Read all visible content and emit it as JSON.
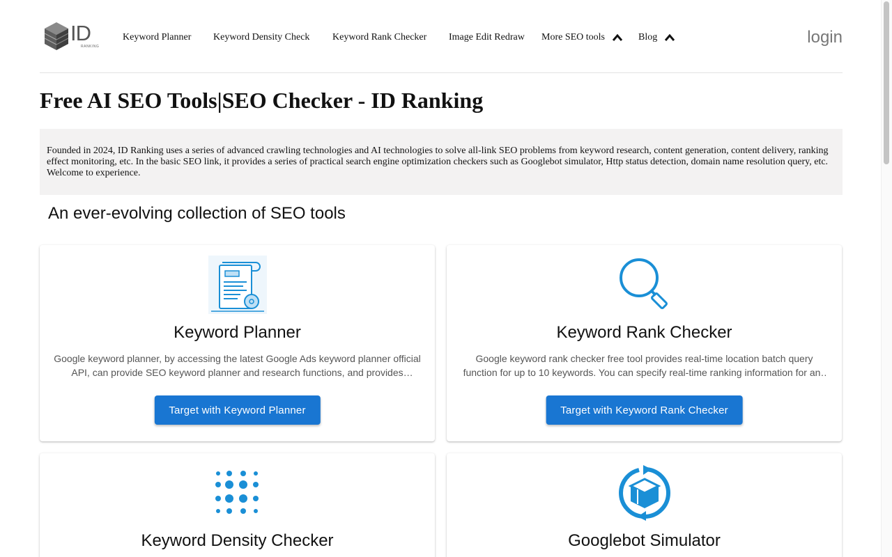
{
  "brand": {
    "logo_text": "ID",
    "logo_sub": "RANKING"
  },
  "nav": {
    "items": [
      {
        "label": "Keyword Planner"
      },
      {
        "label": "Keyword Density Check"
      },
      {
        "label": "Keyword Rank Checker"
      },
      {
        "label": "Image Edit Redraw"
      },
      {
        "label": "More SEO tools",
        "icon": "chevron-up-icon"
      },
      {
        "label": "Blog",
        "icon": "chevron-up-icon"
      }
    ],
    "login": "login"
  },
  "page": {
    "title": "Free AI SEO Tools|SEO Checker - ID Ranking",
    "intro": "Founded in 2024, ID Ranking uses a series of advanced crawling technologies and AI technologies to solve all-link SEO problems from keyword research, content generation, content delivery, ranking effect monitoring, etc. In the basic SEO link, it provides a series of practical search engine optimization checkers such as Googlebot simulator, Http status detection, domain name resolution query, etc. Welcome to experience.",
    "section_title": "An ever-evolving collection of SEO tools"
  },
  "cards": [
    {
      "icon": "document-certificate-icon",
      "title": "Keyword Planner",
      "description": "Google keyword planner, by accessing the latest Google Ads keyword planner official API, can provide SEO keyword planner and research functions, and provides keyword search volume, trend and competition data.",
      "button": "Target with Keyword Planner"
    },
    {
      "icon": "magnifier-icon",
      "title": "Keyword Rank Checker",
      "description": "Google keyword rank checker free tool provides real-time location batch query function for up to 10 keywords. You can specify real-time ranking information for any location and language.",
      "button": "Target with Keyword Rank Checker"
    },
    {
      "icon": "dot-grid-icon",
      "title": "Keyword Density Checker"
    },
    {
      "icon": "rotating-box-icon",
      "title": "Googlebot Simulator"
    }
  ],
  "colors": {
    "accent": "#1976d2",
    "icon_blue": "#1a8fd6",
    "intro_bg": "#f3f2f2"
  }
}
